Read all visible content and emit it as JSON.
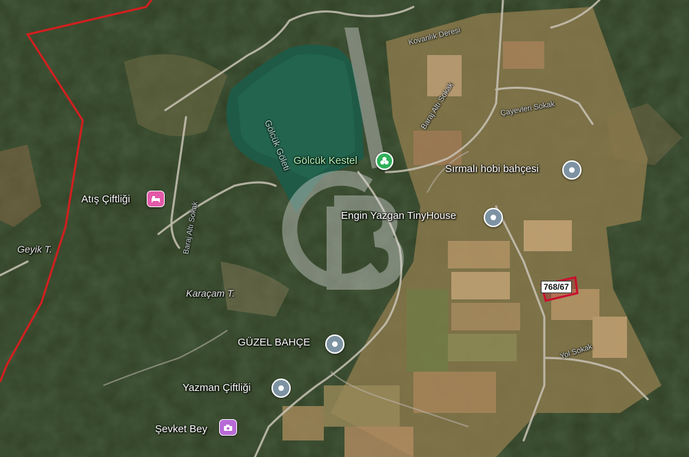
{
  "map": {
    "type": "satellite",
    "pois": [
      {
        "id": "golcuk-kestel",
        "label": "Gölcük Kestel",
        "icon": "park-icon",
        "color": "#2fb05a"
      },
      {
        "id": "sirmali",
        "label": "Sırmalı hobi bahçesi",
        "icon": "location-pin-icon",
        "color": "#7d93a3"
      },
      {
        "id": "engin",
        "label": "Engin Yazgan TinyHouse",
        "icon": "location-pin-icon",
        "color": "#7d93a3"
      },
      {
        "id": "atis",
        "label": "Atış Çiftliği",
        "icon": "hotel-bed-icon",
        "color": "#e35aa8"
      },
      {
        "id": "guzel",
        "label": "GÜZEL BAHÇE",
        "icon": "location-pin-icon",
        "color": "#7d93a3"
      },
      {
        "id": "yazman",
        "label": "Yazman Çiftliği",
        "icon": "location-pin-icon",
        "color": "#7d93a3"
      },
      {
        "id": "sevket",
        "label": "Şevket Bey",
        "icon": "camera-icon",
        "color": "#b86ad6"
      }
    ],
    "places": {
      "geyik": "Geyik T.",
      "karacam": "Karaçam T.",
      "lake": "Gölcük Göleti"
    },
    "roads": {
      "kovanlik": "Kovanlık Deresi",
      "baraj1": "Baraj Altı Sokak",
      "baraj2": "Baraj Altı Sokak",
      "cayavi": "Çayevleri Sokak",
      "yol": "Yol Sokak"
    },
    "parcel": {
      "label": "768/67",
      "color": "#c8102e"
    },
    "boundary_color": "#d21f1f",
    "watermark": "CB"
  }
}
